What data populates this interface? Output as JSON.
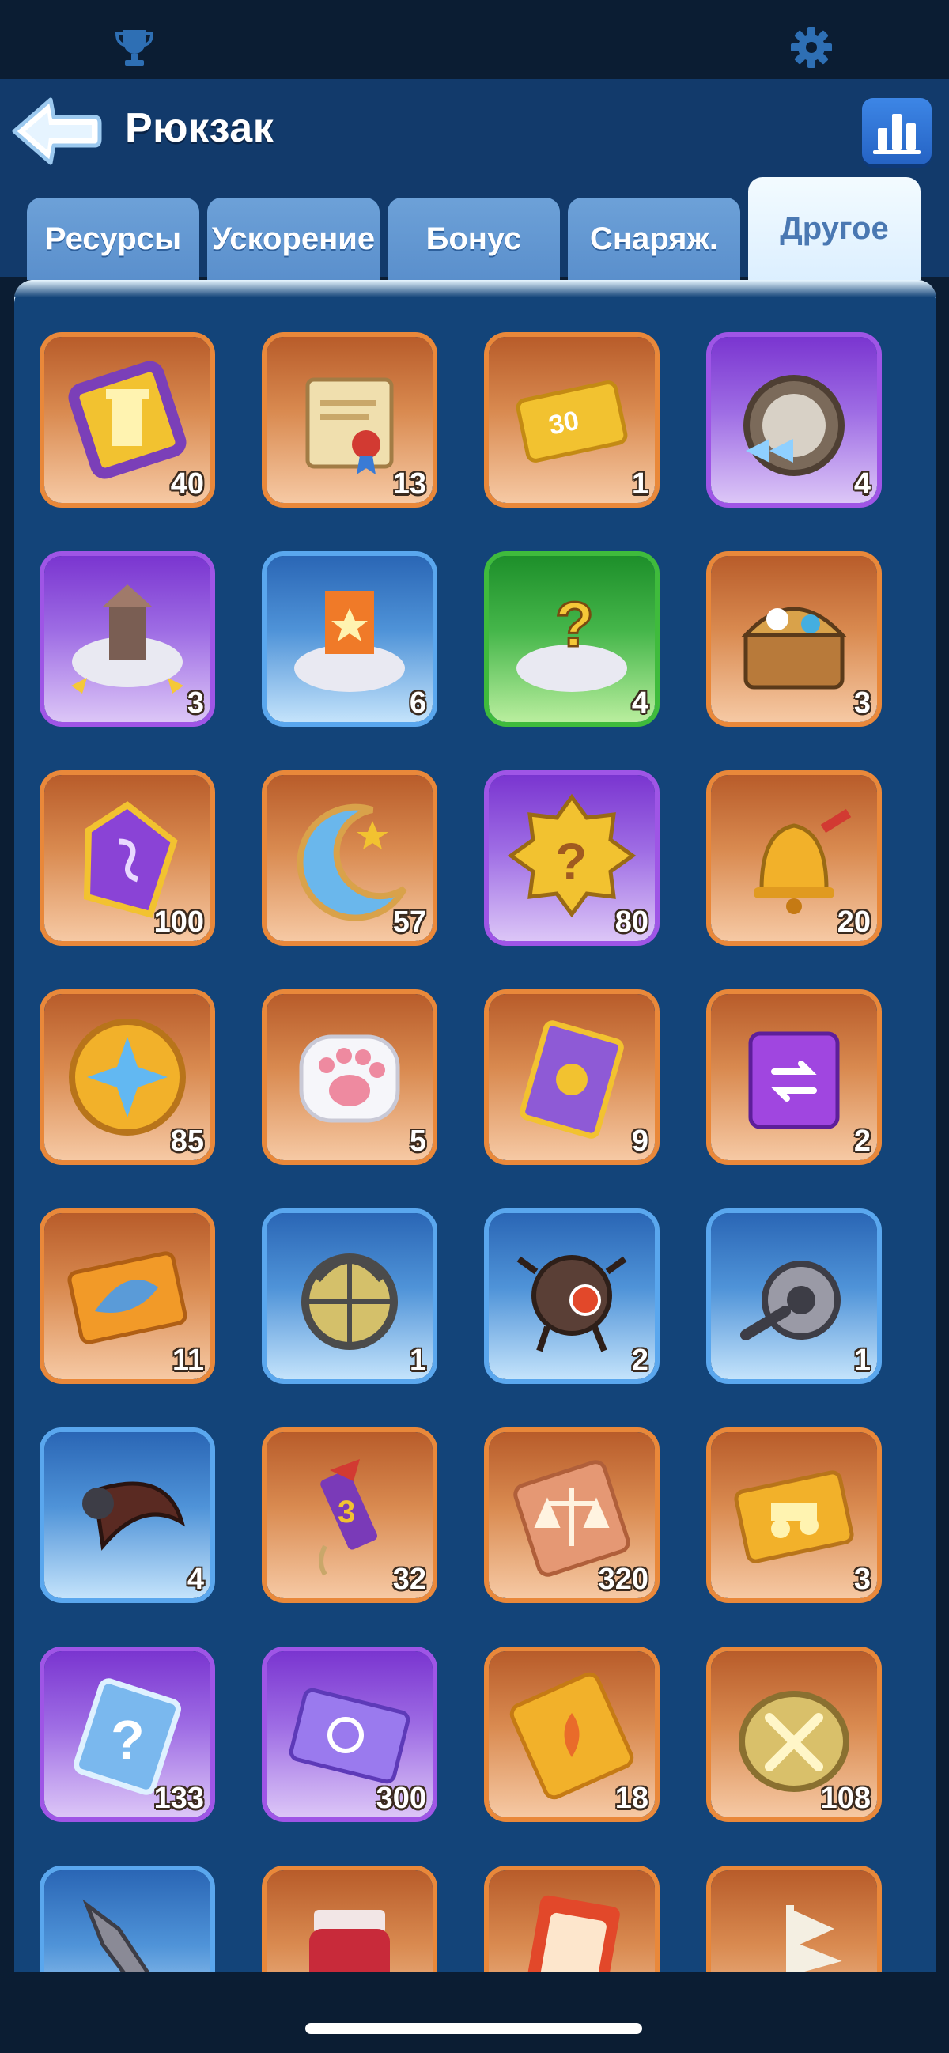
{
  "header": {
    "title": "Рюкзак",
    "icons": {
      "top_left": "trophy-icon",
      "top_right": "gear-icon",
      "back": "back-arrow-icon",
      "stats": "bar-chart-icon"
    }
  },
  "tabs": [
    {
      "label": "Ресурсы",
      "active": false
    },
    {
      "label": "Ускорение",
      "active": false
    },
    {
      "label": "Бонус",
      "active": false
    },
    {
      "label": "Снаряж.",
      "active": false
    },
    {
      "label": "Другое",
      "active": true
    }
  ],
  "colors": {
    "orange": "#e9883a",
    "purple": "#9f55e6",
    "blue": "#5aa7ee",
    "green": "#3fbb3c",
    "panel": "#134479",
    "header": "#123a6b"
  },
  "items": [
    {
      "icon": "golden-pillar-ticket-icon",
      "rarity": "orange",
      "count": "40"
    },
    {
      "icon": "scroll-with-seal-icon",
      "rarity": "orange",
      "count": "13"
    },
    {
      "icon": "gold-ticket-30-icon",
      "rarity": "orange",
      "count": "1"
    },
    {
      "icon": "compass-speed-icon",
      "rarity": "purple",
      "count": "4"
    },
    {
      "icon": "relocate-building-icon",
      "rarity": "purple",
      "count": "3"
    },
    {
      "icon": "relocate-banner-icon",
      "rarity": "blue",
      "count": "6"
    },
    {
      "icon": "random-relocate-icon",
      "rarity": "green",
      "count": "4"
    },
    {
      "icon": "treasure-chest-icon",
      "rarity": "orange",
      "count": "3"
    },
    {
      "icon": "purple-rune-crystal-icon",
      "rarity": "orange",
      "count": "100"
    },
    {
      "icon": "crescent-moon-icon",
      "rarity": "orange",
      "count": "57"
    },
    {
      "icon": "mystery-badge-icon",
      "rarity": "purple",
      "count": "80"
    },
    {
      "icon": "golden-bell-icon",
      "rarity": "orange",
      "count": "20"
    },
    {
      "icon": "star-coin-icon",
      "rarity": "orange",
      "count": "85"
    },
    {
      "icon": "paw-soap-icon",
      "rarity": "orange",
      "count": "5"
    },
    {
      "icon": "purple-card-icon",
      "rarity": "orange",
      "count": "9"
    },
    {
      "icon": "swap-ticket-icon",
      "rarity": "orange",
      "count": "2"
    },
    {
      "icon": "fish-ticket-icon",
      "rarity": "orange",
      "count": "11"
    },
    {
      "icon": "lantern-cage-icon",
      "rarity": "blue",
      "count": "1"
    },
    {
      "icon": "robot-drone-icon",
      "rarity": "blue",
      "count": "2"
    },
    {
      "icon": "fishing-reel-icon",
      "rarity": "blue",
      "count": "1"
    },
    {
      "icon": "scythe-blade-icon",
      "rarity": "blue",
      "count": "4"
    },
    {
      "icon": "firework-rocket-icon",
      "rarity": "orange",
      "count": "32"
    },
    {
      "icon": "scales-ticket-icon",
      "rarity": "orange",
      "count": "320"
    },
    {
      "icon": "cart-ticket-icon",
      "rarity": "orange",
      "count": "3"
    },
    {
      "icon": "mystery-card-icon",
      "rarity": "purple",
      "count": "133"
    },
    {
      "icon": "purple-wheel-ticket-icon",
      "rarity": "purple",
      "count": "300"
    },
    {
      "icon": "flower-ticket-icon",
      "rarity": "orange",
      "count": "18"
    },
    {
      "icon": "swords-medallion-icon",
      "rarity": "orange",
      "count": "108"
    },
    {
      "icon": "blade-tool-icon",
      "rarity": "blue",
      "count": ""
    },
    {
      "icon": "jam-jar-icon",
      "rarity": "orange",
      "count": ""
    },
    {
      "icon": "dessert-card-icon",
      "rarity": "orange",
      "count": ""
    },
    {
      "icon": "pirate-ship-icon",
      "rarity": "orange",
      "count": ""
    }
  ]
}
